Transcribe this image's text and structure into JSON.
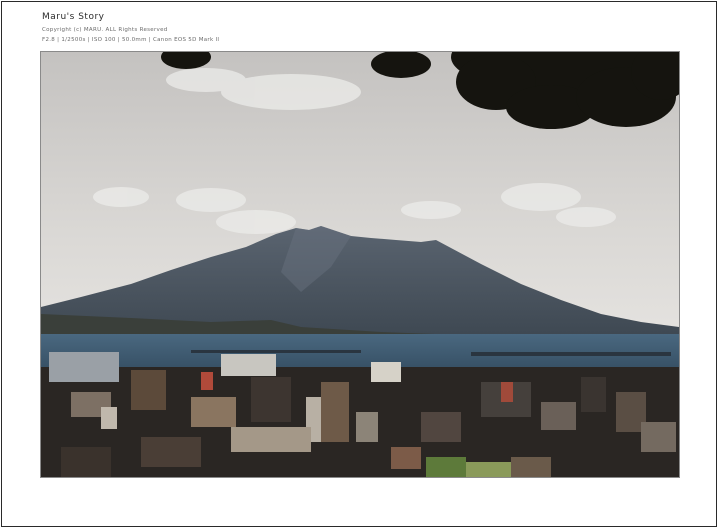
{
  "header": {
    "title": "Maru's Story",
    "copyright": "Copyright (c) MARU. ALL Rights Reserved",
    "exif": "F2.8 | 1/2500s | ISO 100 | 50.0mm | Canon EOS 5D Mark II"
  },
  "photo": {
    "subject": "volcano-over-bay-with-city",
    "colors": {
      "sky_top": "#c9c7c5",
      "sky_bottom": "#e4e2df",
      "mountain": "#4d5660",
      "mountain_light": "#6b7480",
      "sea": "#3f5a70",
      "city_dark": "#2a2623",
      "foliage": "#15140f"
    }
  }
}
